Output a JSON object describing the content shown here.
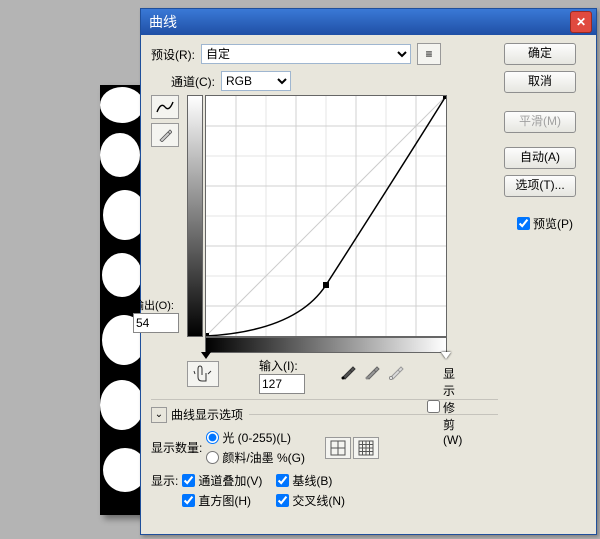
{
  "title": "曲线",
  "preset_label": "预设(R):",
  "preset_value": "自定",
  "channel_label": "通道(C):",
  "channel_value": "RGB",
  "output_label": "输出(O):",
  "output_value": "54",
  "input_label": "输入(I):",
  "input_value": "127",
  "clip_label": "显示修剪(W)",
  "options_header": "曲线显示选项",
  "display_amount_label": "显示数量:",
  "display_light": "光 (0-255)(L)",
  "display_ink": "颜料/油墨 %(G)",
  "show_label": "显示:",
  "show_overlay": "通道叠加(V)",
  "show_baseline": "基线(B)",
  "show_histogram": "直方图(H)",
  "show_intersection": "交叉线(N)",
  "buttons": {
    "ok": "确定",
    "cancel": "取消",
    "smooth": "平滑(M)",
    "auto": "自动(A)",
    "options": "选项(T)...",
    "preview": "预览(P)"
  }
}
